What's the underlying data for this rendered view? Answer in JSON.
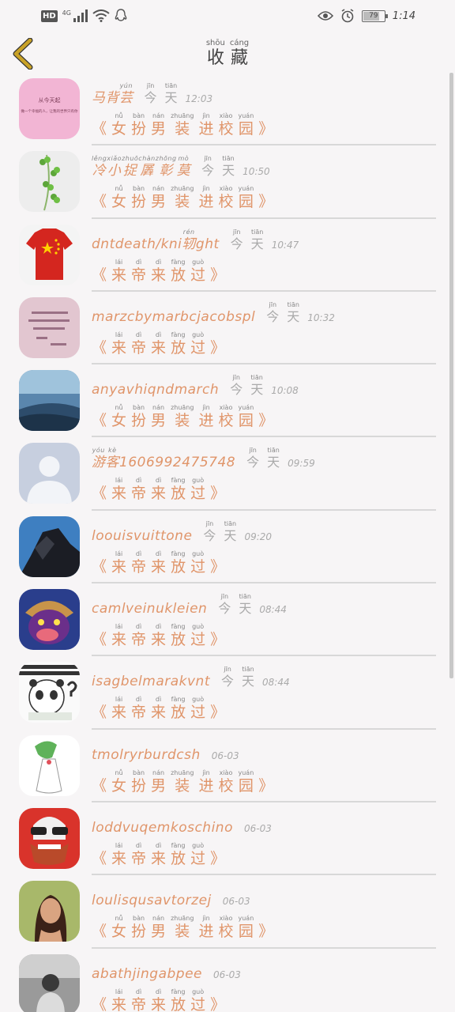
{
  "status_bar": {
    "hd": "HD",
    "network": "4G",
    "battery": "79",
    "battery_level": 0.79,
    "time": "1:14"
  },
  "header": {
    "title": [
      {
        "py": "shōu",
        "hz": "收"
      },
      {
        "py": "cáng",
        "hz": "藏"
      }
    ]
  },
  "messages": {
    "girl": [
      {
        "py": "",
        "hz": "《"
      },
      {
        "py": "nǚ",
        "hz": "女"
      },
      {
        "py": "bàn",
        "hz": "扮"
      },
      {
        "py": "nán",
        "hz": "男"
      },
      {
        "py": "zhuāng",
        "hz": "装"
      },
      {
        "py": "jìn",
        "hz": "进"
      },
      {
        "py": "xiào",
        "hz": "校"
      },
      {
        "py": "yuán",
        "hz": "园"
      },
      {
        "py": "",
        "hz": "》"
      }
    ],
    "lai": [
      {
        "py": "",
        "hz": "《"
      },
      {
        "py": "lái",
        "hz": "来"
      },
      {
        "py": "dì",
        "hz": "帝"
      },
      {
        "py": "dì",
        "hz": "来"
      },
      {
        "py": "fàng",
        "hz": "放"
      },
      {
        "py": "guò",
        "hz": "过"
      },
      {
        "py": "",
        "hz": "》"
      }
    ]
  },
  "favorites": [
    {
      "name": [
        {
          "py": "",
          "hz": "马"
        },
        {
          "py": "",
          "hz": "背"
        },
        {
          "py": "yún",
          "hz": "芸"
        }
      ],
      "day": [
        {
          "py": "jīn",
          "hz": "今"
        },
        {
          "py": "tiān",
          "hz": "天"
        }
      ],
      "time": "12:03",
      "msg": "girl",
      "avatar": "pink-text"
    },
    {
      "name": [
        {
          "py": "lěng",
          "hz": "冷"
        },
        {
          "py": "xiǎo",
          "hz": "小"
        },
        {
          "py": "zhuō",
          "hz": "捉"
        },
        {
          "py": "chàn",
          "hz": "羼"
        },
        {
          "py": "zhōng",
          "hz": "彰"
        },
        {
          "py": "mò",
          "hz": "莫"
        }
      ],
      "day": [
        {
          "py": "jīn",
          "hz": "今"
        },
        {
          "py": "tiān",
          "hz": "天"
        }
      ],
      "time": "10:50",
      "msg": "girl",
      "avatar": "clover"
    },
    {
      "name": [
        {
          "py": "",
          "hz": "dntdeath/kni"
        },
        {
          "py": "rén",
          "hz": "轫"
        },
        {
          "py": "",
          "hz": "ght"
        }
      ],
      "day": [
        {
          "py": "jīn",
          "hz": "今"
        },
        {
          "py": "tiān",
          "hz": "天"
        }
      ],
      "time": "10:47",
      "msg": "lai",
      "avatar": "flag-shirt"
    },
    {
      "name": [
        {
          "py": "",
          "hz": "marzcbymarbcjacobspl"
        }
      ],
      "day": [
        {
          "py": "jīn",
          "hz": "今"
        },
        {
          "py": "tiān",
          "hz": "天"
        }
      ],
      "time": "10:32",
      "msg": "lai",
      "avatar": "pink-quote"
    },
    {
      "name": [
        {
          "py": "",
          "hz": "anyavhiqndmarch"
        }
      ],
      "day": [
        {
          "py": "jīn",
          "hz": "今"
        },
        {
          "py": "tiān",
          "hz": "天"
        }
      ],
      "time": "10:08",
      "msg": "girl",
      "avatar": "sky"
    },
    {
      "name": [
        {
          "py": "yóu",
          "hz": "游"
        },
        {
          "py": "kè",
          "hz": "客"
        },
        {
          "py": "",
          "hz": "1606992475748"
        }
      ],
      "day": [
        {
          "py": "jīn",
          "hz": "今"
        },
        {
          "py": "tiān",
          "hz": "天"
        }
      ],
      "time": "09:59",
      "msg": "lai",
      "avatar": "default-user"
    },
    {
      "name": [
        {
          "py": "",
          "hz": "loouisvuittone"
        }
      ],
      "day": [
        {
          "py": "jīn",
          "hz": "今"
        },
        {
          "py": "tiān",
          "hz": "天"
        }
      ],
      "time": "09:20",
      "msg": "lai",
      "avatar": "anime-dark"
    },
    {
      "name": [
        {
          "py": "",
          "hz": "camlveinukleien"
        }
      ],
      "day": [
        {
          "py": "jīn",
          "hz": "今"
        },
        {
          "py": "tiān",
          "hz": "天"
        }
      ],
      "time": "08:44",
      "msg": "lai",
      "avatar": "monster"
    },
    {
      "name": [
        {
          "py": "",
          "hz": "isagbelmarakvnt"
        }
      ],
      "day": [
        {
          "py": "jīn",
          "hz": "今"
        },
        {
          "py": "tiān",
          "hz": "天"
        }
      ],
      "time": "08:44",
      "msg": "lai",
      "avatar": "panda-meme"
    },
    {
      "name": [
        {
          "py": "",
          "hz": "tmolryrburdcsh"
        }
      ],
      "day": [],
      "time": "06-03",
      "msg": "girl",
      "avatar": "gardevoir"
    },
    {
      "name": [
        {
          "py": "",
          "hz": "loddvuqemkoschino"
        }
      ],
      "day": [],
      "time": "06-03",
      "msg": "lai",
      "avatar": "skull"
    },
    {
      "name": [
        {
          "py": "",
          "hz": "loulisqusavtorzej"
        }
      ],
      "day": [],
      "time": "06-03",
      "msg": "girl",
      "avatar": "woman"
    },
    {
      "name": [
        {
          "py": "",
          "hz": "abathjingabpee"
        }
      ],
      "day": [],
      "time": "06-03",
      "msg": "lai",
      "avatar": "bw-photo"
    }
  ],
  "avatar_texts": {
    "pink_text_line1": "从今天起",
    "pink_text_line2": "做一个幸福的人，让我的世界只有你"
  },
  "colors": {
    "accent": "#e0956a",
    "back_arrow": "#c9a227",
    "background": "#f7f5f6"
  },
  "icons": {
    "back": "chevron-left-icon"
  }
}
